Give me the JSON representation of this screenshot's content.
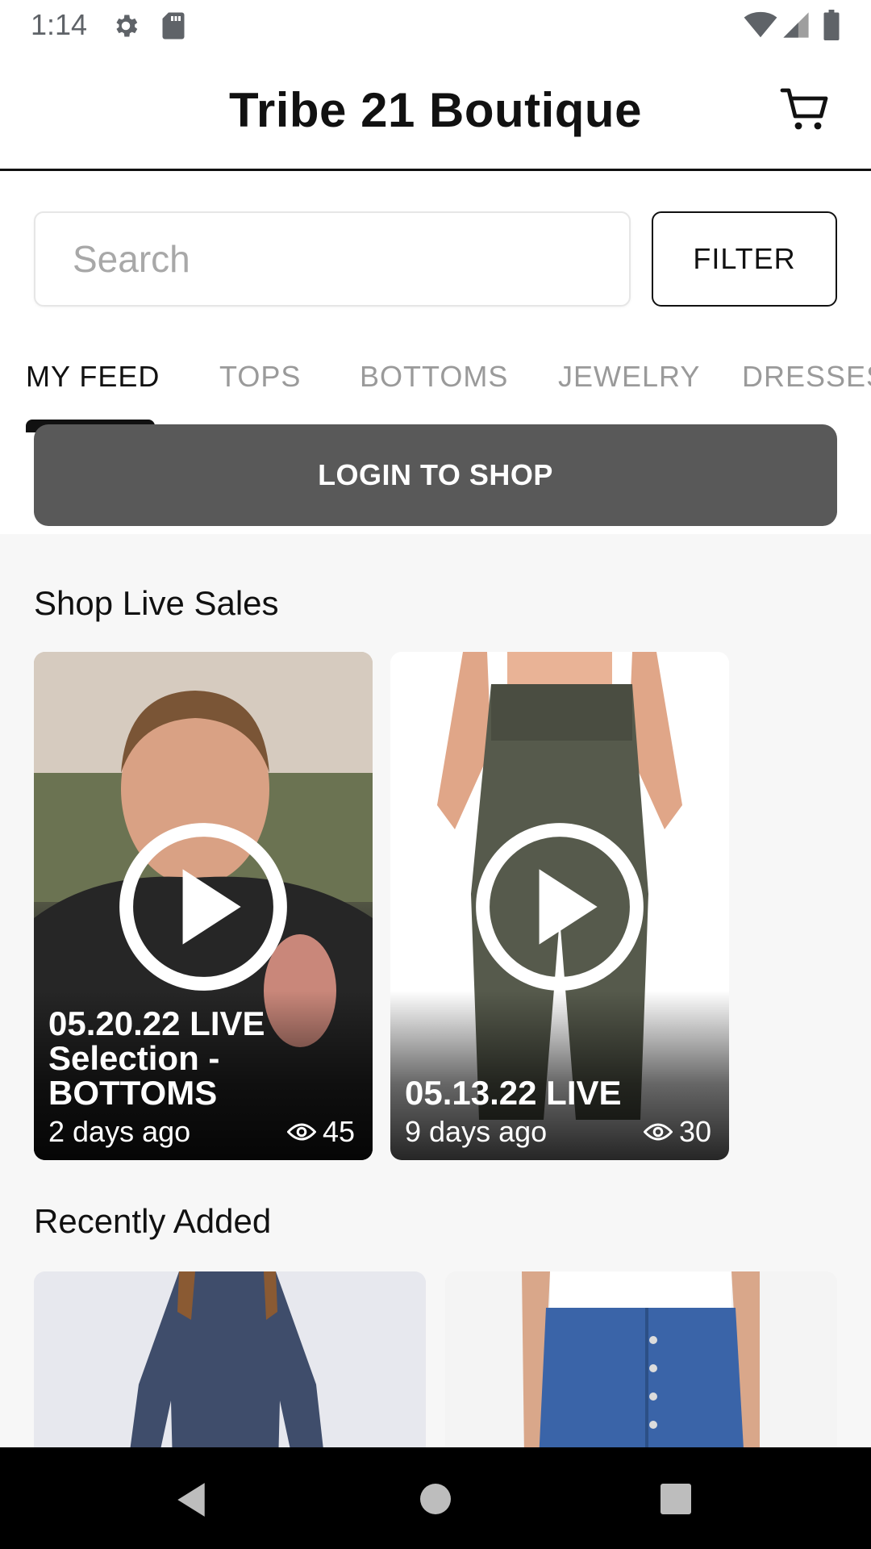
{
  "status_bar": {
    "time": "1:14",
    "icons": [
      "gear-icon",
      "sd-card-icon",
      "wifi-icon",
      "signal-icon",
      "battery-icon"
    ]
  },
  "header": {
    "title": "Tribe 21 Boutique",
    "cart_icon": "cart-icon"
  },
  "search": {
    "placeholder": "Search",
    "value": "",
    "filter_label": "FILTER"
  },
  "tabs": [
    {
      "label": "MY FEED",
      "active": true
    },
    {
      "label": "TOPS",
      "active": false
    },
    {
      "label": "BOTTOMS",
      "active": false
    },
    {
      "label": "JEWELRY",
      "active": false
    },
    {
      "label": "DRESSES",
      "active": false
    }
  ],
  "login_button": "LOGIN TO SHOP",
  "live_sales": {
    "title": "Shop Live Sales",
    "items": [
      {
        "title": "05.20.22 LIVE Selection - BOTTOMS",
        "time": "2 days ago",
        "views": "45"
      },
      {
        "title": "05.13.22 LIVE",
        "time": "9 days ago",
        "views": "30"
      }
    ]
  },
  "recently_added": {
    "title": "Recently Added"
  },
  "colors": {
    "login_button_bg": "#595959",
    "active_tab": "#111111",
    "inactive_tab": "#9a9a9a"
  },
  "nav": {
    "icons": [
      "back-icon",
      "home-icon",
      "recent-apps-icon"
    ]
  }
}
